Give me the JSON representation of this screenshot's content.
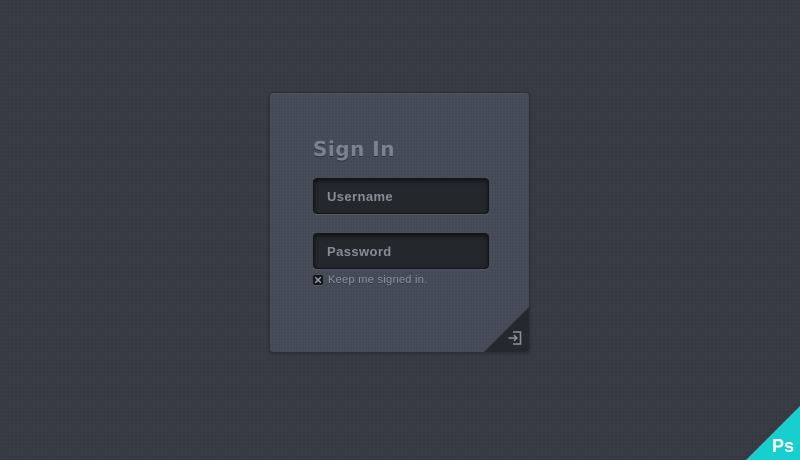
{
  "sign_in": {
    "title": "Sign In",
    "username_placeholder": "Username",
    "password_placeholder": "Password",
    "remember_label": "Keep me signed in.",
    "remember_checked": true,
    "submit_icon": "login-icon"
  },
  "badge": {
    "text": "Ps",
    "color": "#18cfd0"
  },
  "colors": {
    "background": "#363b44",
    "card": "#434a55",
    "field": "#24272c",
    "corner": "#25282d"
  }
}
